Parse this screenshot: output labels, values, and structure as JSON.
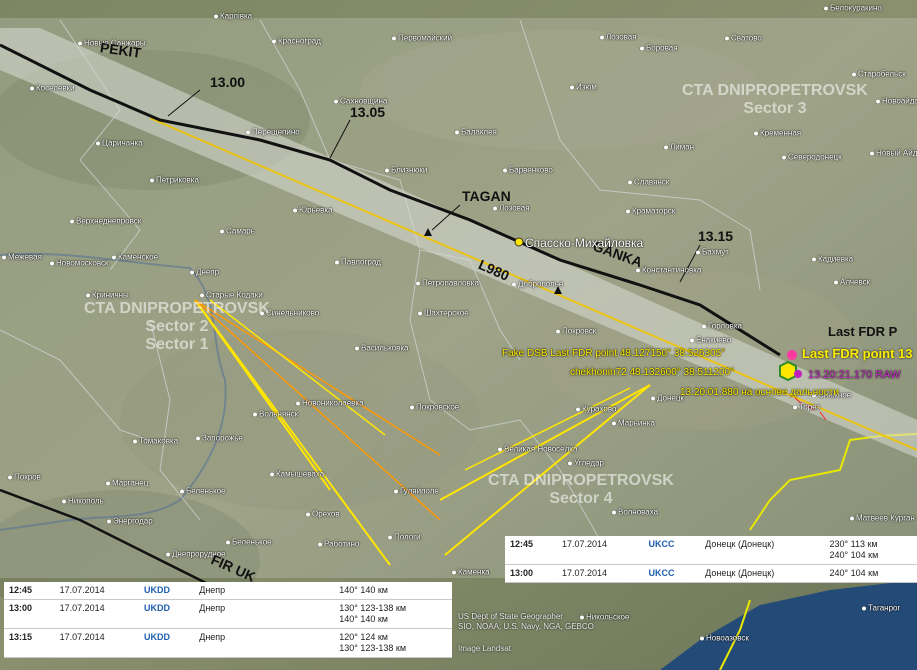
{
  "towns": [
    {
      "name": "Карлівка"
    },
    {
      "name": "Новые Санжары"
    },
    {
      "name": "Красноград"
    },
    {
      "name": "Первомайский"
    },
    {
      "name": "Лозовая"
    },
    {
      "name": "Боровая"
    },
    {
      "name": "Сватово"
    },
    {
      "name": "Белокуракино"
    },
    {
      "name": "Старобельск"
    },
    {
      "name": "Новоайдар"
    },
    {
      "name": "Кременная"
    },
    {
      "name": "Северодонецк"
    },
    {
      "name": "Новый Айдар"
    },
    {
      "name": "Лиман"
    },
    {
      "name": "Славянск"
    },
    {
      "name": "Краматорск"
    },
    {
      "name": "Бахмут"
    },
    {
      "name": "Кадиевка"
    },
    {
      "name": "Алчевск"
    },
    {
      "name": "Константиновка"
    },
    {
      "name": "Барвенково"
    },
    {
      "name": "Изюм"
    },
    {
      "name": "Балаклея"
    },
    {
      "name": "Близнюки"
    },
    {
      "name": "Перещепино"
    },
    {
      "name": "Сахновщина"
    },
    {
      "name": "Юрьевка"
    },
    {
      "name": "Лозовая"
    },
    {
      "name": "Коcелевки"
    },
    {
      "name": "Царичанка"
    },
    {
      "name": "Верхнеднепровск"
    },
    {
      "name": "Петриковка"
    },
    {
      "name": "Самарь"
    },
    {
      "name": "Каменское"
    },
    {
      "name": "Днепр"
    },
    {
      "name": "Криничны"
    },
    {
      "name": "Старые Кодаки"
    },
    {
      "name": "Синельниково"
    },
    {
      "name": "Павлоград"
    },
    {
      "name": "Петропавловка"
    },
    {
      "name": "Межевая"
    },
    {
      "name": "Шахтерское"
    },
    {
      "name": "Добропольe"
    },
    {
      "name": "Покровск"
    },
    {
      "name": "Новомосковск"
    },
    {
      "name": "Васильковка"
    },
    {
      "name": "Новониколаевка"
    },
    {
      "name": "Вольнянск"
    },
    {
      "name": "Покровское"
    },
    {
      "name": "Курахово"
    },
    {
      "name": "Марьинка"
    },
    {
      "name": "Донецк"
    },
    {
      "name": "Горловка"
    },
    {
      "name": "Енакиево"
    },
    {
      "name": "Снежное"
    },
    {
      "name": "Торез"
    },
    {
      "name": "Томаковка"
    },
    {
      "name": "Запорожье"
    },
    {
      "name": "Камышеваха"
    },
    {
      "name": "Беленькое"
    },
    {
      "name": "Покров"
    },
    {
      "name": "Марганец"
    },
    {
      "name": "Никополь"
    },
    {
      "name": "Энергодар"
    },
    {
      "name": "Днепрорудное"
    },
    {
      "name": "Беленькое"
    },
    {
      "name": "Орехов"
    },
    {
      "name": "Работино"
    },
    {
      "name": "Пологи"
    },
    {
      "name": "Гуляйполе"
    },
    {
      "name": "Великая Новосёлка"
    },
    {
      "name": "Угледар"
    },
    {
      "name": "Волноваха"
    },
    {
      "name": "Каменка"
    },
    {
      "name": "Никольское"
    },
    {
      "name": "Матвеев Курган"
    },
    {
      "name": "Таганрог"
    },
    {
      "name": "Новоазовск"
    }
  ],
  "fixes": {
    "time_1300": "13.00",
    "time_1305": "13.05",
    "time_1315": "13.15",
    "tagan": "TAGAN",
    "ganka": "GANKA",
    "l980": "L980",
    "pekit": "PEKIT",
    "fir": "FIR UK"
  },
  "sectors": [
    {
      "l1": "CTA DNIPROPETROVSK",
      "l2": "Sector 3"
    },
    {
      "l1": "CTA DNIPROPETROVSK",
      "l2": "Sector 2",
      "l3": "Sector 1"
    },
    {
      "l1": "CTA DNIPROPETROVSK",
      "l2": "Sector 4"
    }
  ],
  "labels": {
    "spassk": "Спасско-Михайловка",
    "fake_dsb": "Fake DSB Last FDR point 48.127150° 38.526305°",
    "chekhonin": "chekhonin72 48.132600° 38.511200°",
    "time_dist": "13.20:01.880 на основе дальности",
    "raw": "13.20:21.170 RAW",
    "last_fdr_p": "Last FDR P",
    "last_fdr_13": "Last FDR point 13"
  },
  "table_left": {
    "rows": [
      {
        "time": "12:45",
        "date": "17.07.2014",
        "code": "UKDD",
        "city": "Днепр",
        "bearing": [
          "140° 140 км"
        ]
      },
      {
        "time": "13:00",
        "date": "17.07.2014",
        "code": "UKDD",
        "city": "Днепр",
        "bearing": [
          "130° 123-138 км",
          "140° 140 км"
        ]
      },
      {
        "time": "13:15",
        "date": "17.07.2014",
        "code": "UKDD",
        "city": "Днепр",
        "bearing": [
          "120° 124 км",
          "130° 123-138 км"
        ]
      }
    ]
  },
  "table_right": {
    "rows": [
      {
        "time": "12:45",
        "date": "17.07.2014",
        "code": "UKCC",
        "city": "Донецк (Донецк)",
        "bearing": [
          "230° 113 км",
          "240° 104 км"
        ]
      },
      {
        "time": "13:00",
        "date": "17.07.2014",
        "code": "UKCC",
        "city": "Донецк (Донецк)",
        "bearing": [
          "240° 104 км"
        ]
      }
    ]
  },
  "attribution": {
    "a": "US Dept of State Geographer",
    "b": "SIO, NOAA, U.S. Navy, NGA, GEBCO",
    "c": "Image Landsat"
  },
  "colors": {
    "corridor": "#c9d0c6",
    "track_black": "#111111",
    "track_yellow": "#f0c400",
    "bearing_yellow": "#ffe600",
    "bearing_orange": "#ff9900",
    "border_yellow": "#e8e800",
    "accent_blue": "#1f5fae"
  }
}
